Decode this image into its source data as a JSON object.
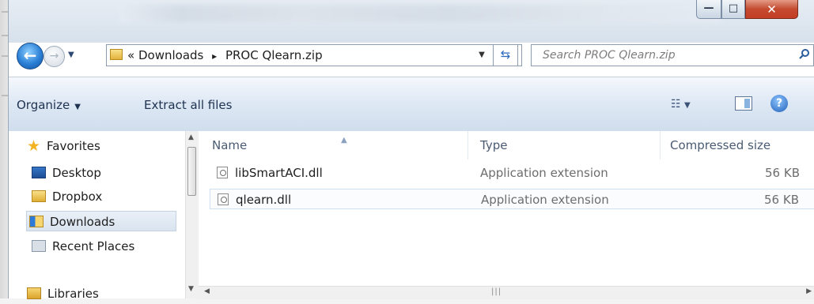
{
  "window": {
    "caption_minimize": "—",
    "caption_maximize": "□",
    "caption_close": "✕"
  },
  "nav": {
    "address_overflow": "«",
    "breadcrumb": [
      "Downloads",
      "PROC Qlearn.zip"
    ],
    "breadcrumb_sep": "▸",
    "search_placeholder": "Search PROC Qlearn.zip"
  },
  "commands": {
    "organize": "Organize",
    "extract": "Extract all files"
  },
  "sidebar": {
    "items": [
      {
        "label": "Favorites",
        "icon": "star-icon"
      },
      {
        "label": "Desktop",
        "icon": "desktop-icon"
      },
      {
        "label": "Dropbox",
        "icon": "folder-icon"
      },
      {
        "label": "Downloads",
        "icon": "downloads-folder-icon",
        "selected": true
      },
      {
        "label": "Recent Places",
        "icon": "recent-places-icon"
      },
      {
        "label": "Libraries",
        "icon": "libraries-icon"
      }
    ]
  },
  "files": {
    "columns": [
      "Name",
      "Type",
      "Compressed size"
    ],
    "rows": [
      {
        "name": "libSmartACI.dll",
        "type": "Application extension",
        "size": "56 KB"
      },
      {
        "name": "qlearn.dll",
        "type": "Application extension",
        "size": "56 KB"
      }
    ]
  },
  "colors": {
    "accent": "#2a7fd6",
    "command_bar": "#dfe9f5",
    "close_button": "#c44a2f"
  }
}
